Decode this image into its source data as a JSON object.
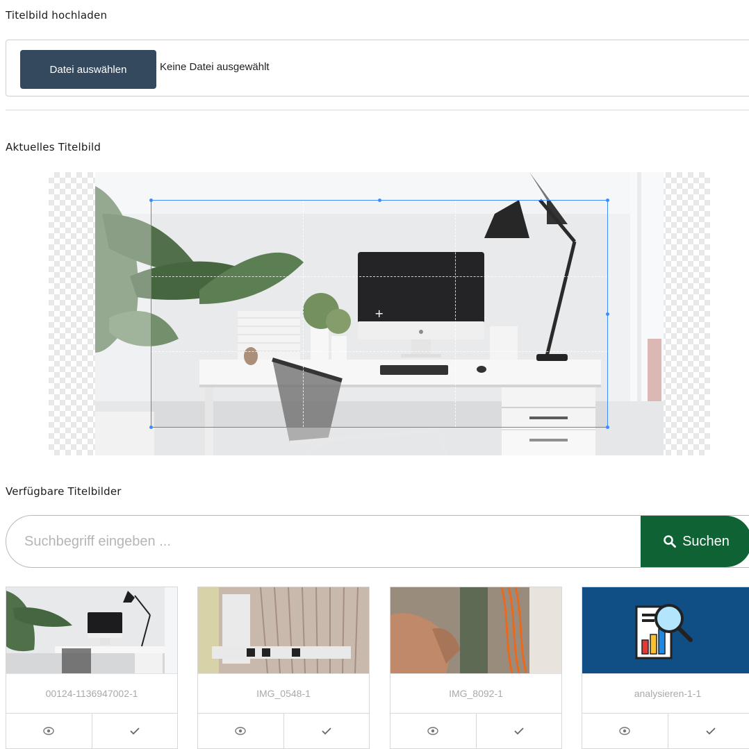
{
  "upload": {
    "label": "Titelbild hochladen",
    "button_label": "Datei auswählen",
    "status": "Keine Datei ausgewählt"
  },
  "current": {
    "label": "Aktuelles Titelbild"
  },
  "available": {
    "label": "Verfügbare Titelbilder",
    "search_placeholder": "Suchbegriff eingeben ...",
    "search_button": "Suchen",
    "cards": [
      {
        "caption": "00124-1136947002-1"
      },
      {
        "caption": "IMG_0548-1"
      },
      {
        "caption": "IMG_8092-1"
      },
      {
        "caption": "analysieren-1-1"
      }
    ]
  },
  "colors": {
    "file_button": "#34495e",
    "search_button": "#0e6234",
    "crop_border": "#3d8bff"
  },
  "icons": {
    "search": "magnifier-icon",
    "preview": "eye-icon",
    "select": "check-icon"
  }
}
